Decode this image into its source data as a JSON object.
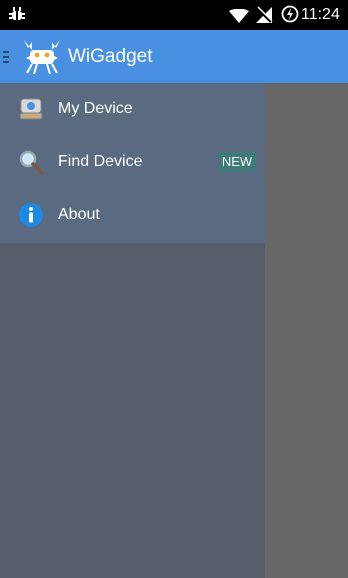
{
  "status_bar": {
    "time": "11:24",
    "icons": [
      "debug-bug-icon",
      "wifi-icon",
      "no-signal-icon",
      "battery-charging-icon"
    ]
  },
  "app_bar": {
    "title": "WiGadget",
    "icons": [
      "hamburger-icon",
      "app-logo-icon"
    ]
  },
  "drawer": {
    "items": [
      {
        "label": "My Device",
        "icon": "device-icon"
      },
      {
        "label": "Find Device",
        "icon": "magnifier-icon",
        "badge": "NEW"
      },
      {
        "label": "About",
        "icon": "info-icon"
      }
    ]
  },
  "colors": {
    "app_bar": "#4a90e2",
    "drawer_menu_bg": "#5a6a80",
    "drawer_bg": "#565e6b",
    "badge_bg": "#3f7a78",
    "scrim": "#676767"
  }
}
